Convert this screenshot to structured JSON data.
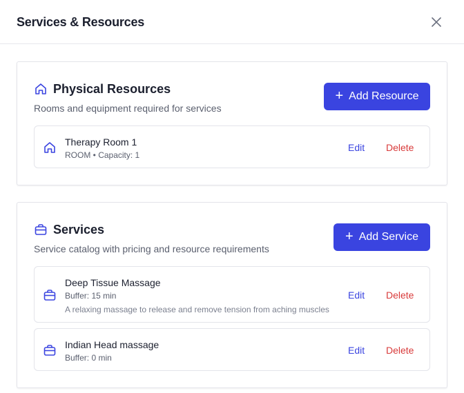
{
  "dialog": {
    "title": "Services & Resources",
    "close_icon": "close-icon"
  },
  "resources": {
    "icon": "home-icon",
    "title": "Physical Resources",
    "subtitle": "Rooms and equipment required for services",
    "add_label": "Add Resource",
    "items": [
      {
        "icon": "home-icon",
        "name": "Therapy Room 1",
        "meta": "ROOM • Capacity: 1",
        "edit_label": "Edit",
        "delete_label": "Delete"
      }
    ]
  },
  "services": {
    "icon": "briefcase-icon",
    "title": "Services",
    "subtitle": "Service catalog with pricing and resource requirements",
    "add_label": "Add Service",
    "items": [
      {
        "icon": "briefcase-icon",
        "name": "Deep Tissue Massage",
        "meta": "Buffer: 15 min",
        "description": "A relaxing massage to release and remove tension from aching muscles",
        "edit_label": "Edit",
        "delete_label": "Delete"
      },
      {
        "icon": "briefcase-icon",
        "name": "Indian Head massage",
        "meta": "Buffer: 0 min",
        "edit_label": "Edit",
        "delete_label": "Delete"
      }
    ]
  },
  "colors": {
    "primary": "#3a44e0",
    "danger": "#d83a3a",
    "border": "#e3e4ea"
  }
}
